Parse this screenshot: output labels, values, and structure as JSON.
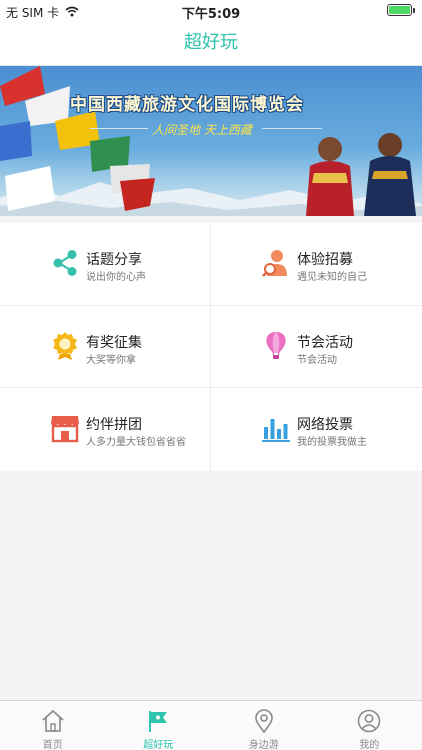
{
  "status_bar": {
    "carrier": "无 SIM 卡",
    "time": "下午5:09"
  },
  "nav": {
    "title": "超好玩"
  },
  "banner": {
    "title": "中国西藏旅游文化国际博览会",
    "subtitle": "人间圣地 天上西藏"
  },
  "menu": [
    {
      "title": "话题分享",
      "subtitle": "说出你的心声",
      "icon": "share-icon"
    },
    {
      "title": "体验招募",
      "subtitle": "遇见未知的自己",
      "icon": "recruit-icon"
    },
    {
      "title": "有奖征集",
      "subtitle": "大奖等你拿",
      "icon": "award-icon"
    },
    {
      "title": "节会活动",
      "subtitle": "节会活动",
      "icon": "hot-air-balloon-icon"
    },
    {
      "title": "约伴拼团",
      "subtitle": "人多力量大钱包省省省",
      "icon": "storefront-icon"
    },
    {
      "title": "网络投票",
      "subtitle": "我的投票我做主",
      "icon": "bar-chart-icon"
    }
  ],
  "tabs": [
    {
      "label": "首页",
      "icon": "home-icon"
    },
    {
      "label": "超好玩",
      "icon": "flag-icon",
      "active": true
    },
    {
      "label": "身边游",
      "icon": "location-pin-icon"
    },
    {
      "label": "我的",
      "icon": "user-icon"
    }
  ],
  "colors": {
    "accent": "#2dc3ad",
    "battery": "#4cd964"
  }
}
